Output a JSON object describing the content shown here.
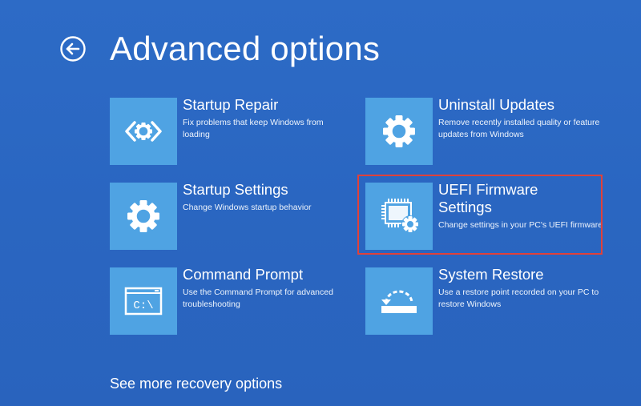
{
  "header": {
    "title": "Advanced options",
    "back_icon": "back-arrow-icon"
  },
  "tiles": [
    {
      "title": "Startup Repair",
      "description": "Fix problems that keep Windows from loading",
      "icon": "startup-repair-icon"
    },
    {
      "title": "Uninstall Updates",
      "description": "Remove recently installed quality or feature updates from Windows",
      "icon": "gear-icon"
    },
    {
      "title": "Startup Settings",
      "description": "Change Windows startup behavior",
      "icon": "gear-icon"
    },
    {
      "title": "UEFI Firmware Settings",
      "description": "Change settings in your PC's UEFI firmware",
      "icon": "firmware-chip-gear-icon"
    },
    {
      "title": "Command Prompt",
      "description": "Use the Command Prompt for advanced troubleshooting",
      "icon": "command-prompt-icon",
      "icon_text": "C:\\"
    },
    {
      "title": "System Restore",
      "description": "Use a restore point recorded on your PC to restore Windows",
      "icon": "system-restore-icon"
    }
  ],
  "footer": {
    "more_link": "See more recovery options"
  },
  "colors": {
    "background": "#2b67c0",
    "tile_icon_bg": "#4fa3e3",
    "highlight_border": "#e0413a",
    "text": "#ffffff"
  }
}
